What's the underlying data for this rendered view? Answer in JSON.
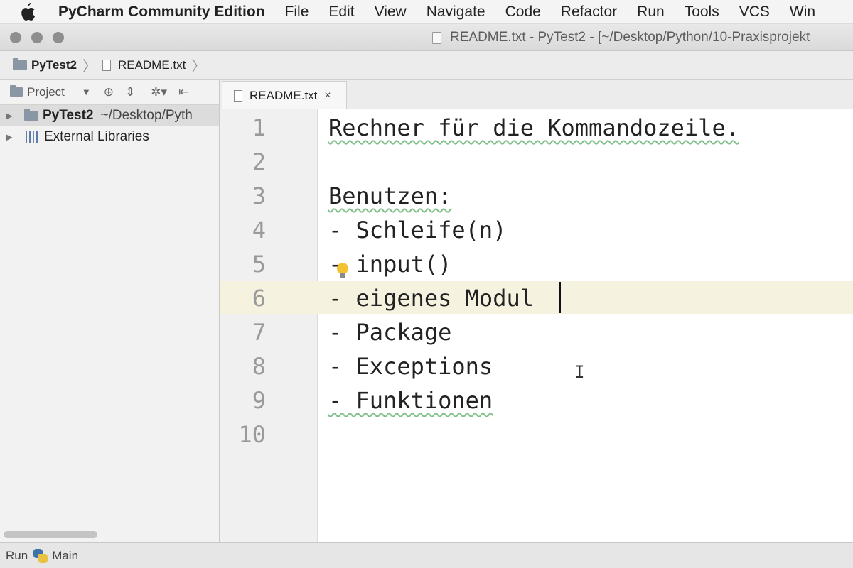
{
  "menubar": {
    "app_name": "PyCharm Community Edition",
    "menus": [
      "File",
      "Edit",
      "View",
      "Navigate",
      "Code",
      "Refactor",
      "Run",
      "Tools",
      "VCS",
      "Win"
    ]
  },
  "window": {
    "title": "README.txt - PyTest2 - [~/Desktop/Python/10-Praxisprojekt"
  },
  "navbar": {
    "project": "PyTest2",
    "file": "README.txt"
  },
  "project_panel": {
    "view_label": "Project",
    "tree": [
      {
        "name": "PyTest2",
        "path": "~/Desktop/Pyth"
      },
      {
        "name": "External Libraries"
      }
    ]
  },
  "editor": {
    "tab_label": "README.txt",
    "close_glyph": "×",
    "lines": [
      {
        "num": "1",
        "text": "Rechner für die Kommandozeile."
      },
      {
        "num": "2",
        "text": ""
      },
      {
        "num": "3",
        "text": "Benutzen:"
      },
      {
        "num": "4",
        "text": "- Schleife(n)"
      },
      {
        "num": "5",
        "text": "- input()"
      },
      {
        "num": "6",
        "text": "- eigenes Modul"
      },
      {
        "num": "7",
        "text": "- Package"
      },
      {
        "num": "8",
        "text": "- Exceptions"
      },
      {
        "num": "9",
        "text": "- Funktionen"
      },
      {
        "num": "10",
        "text": ""
      }
    ],
    "current_line": 6
  },
  "statusbar": {
    "run_label": "Run",
    "config_label": "Main"
  },
  "icons": {
    "apple": "apple-icon",
    "bulb": "lightbulb-icon",
    "python": "python-icon"
  },
  "colors": {
    "current_line_bg": "#f5f2e0",
    "spellcheck": "#7fc08a",
    "folder": "#8a96a3"
  }
}
